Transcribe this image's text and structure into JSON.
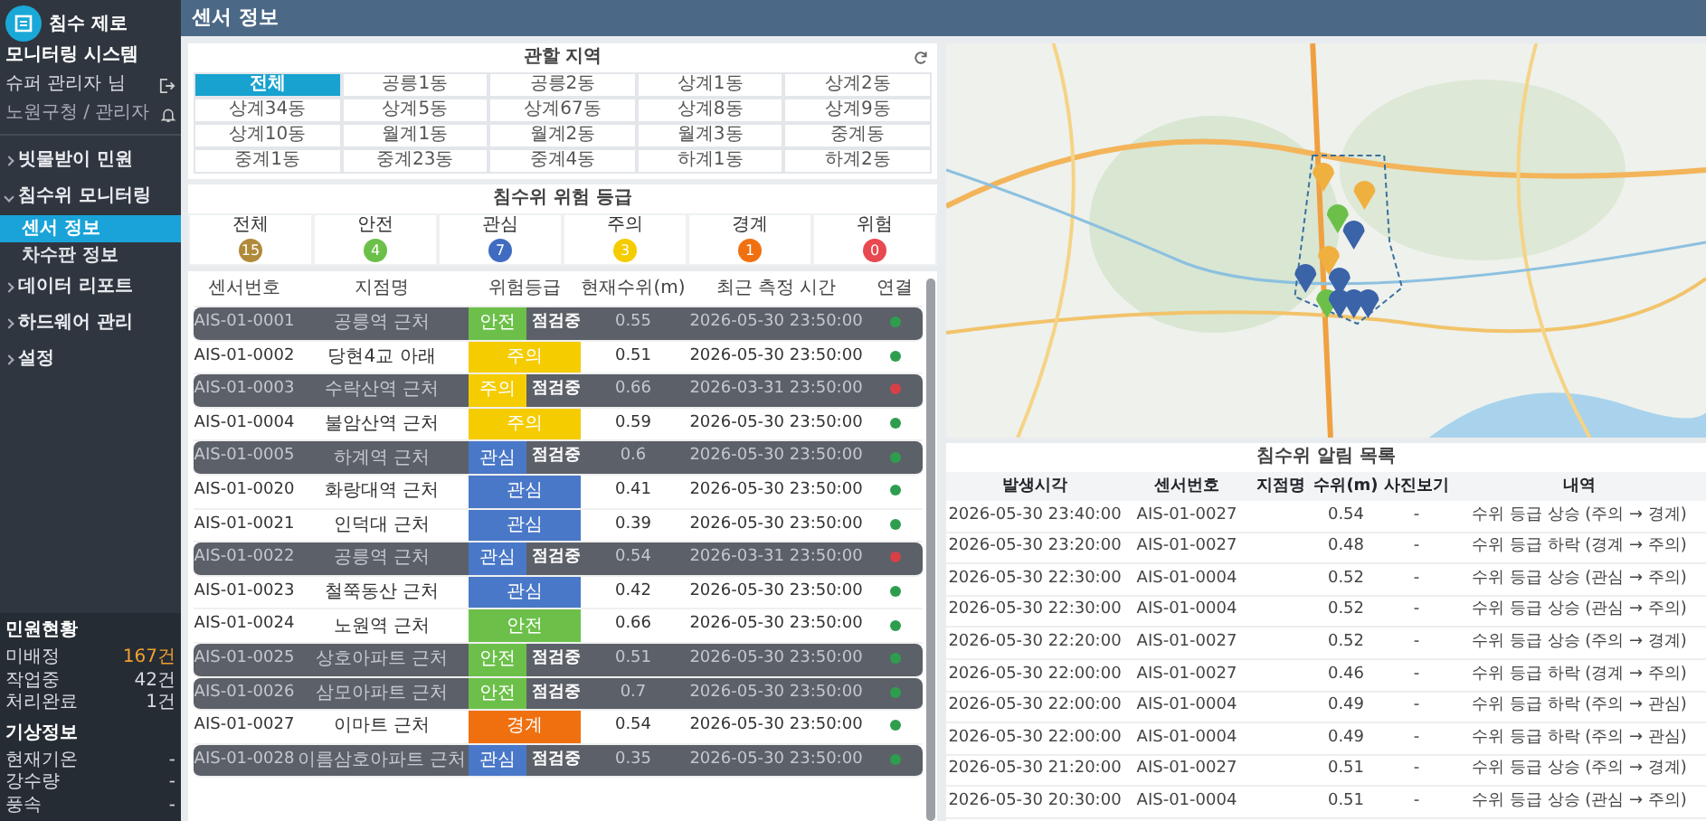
{
  "brand": {
    "title": "침수 제로",
    "subtitle": "모니터링 시스템"
  },
  "user": {
    "name": "슈퍼 관리자 님",
    "role": "노원구청 / 관리자"
  },
  "menu": [
    {
      "label": "빗물받이 민원",
      "expanded": false,
      "selected": false
    },
    {
      "label": "침수위 모니터링",
      "expanded": true,
      "selected": false,
      "children": [
        {
          "label": "센서 정보",
          "selected": true
        },
        {
          "label": "차수판 정보",
          "selected": false
        }
      ]
    },
    {
      "label": "데이터 리포트",
      "expanded": false,
      "selected": false
    },
    {
      "label": "하드웨어 관리",
      "expanded": false,
      "selected": false
    },
    {
      "label": "설정",
      "expanded": false,
      "selected": false
    }
  ],
  "complaints": {
    "title": "민원현황",
    "rows": [
      {
        "label": "미배정",
        "value": "167건",
        "highlight": true
      },
      {
        "label": "작업중",
        "value": "42건",
        "highlight": false
      },
      {
        "label": "처리완료",
        "value": "1건",
        "highlight": false
      }
    ]
  },
  "weather": {
    "title": "기상정보",
    "rows": [
      {
        "label": "현재기온",
        "value": "-"
      },
      {
        "label": "강수량",
        "value": "-"
      },
      {
        "label": "풍속",
        "value": "-"
      }
    ]
  },
  "page_title": "센서 정보",
  "regions": {
    "title": "관할 지역",
    "items": [
      {
        "label": "전체",
        "selected": true
      },
      {
        "label": "공릉1동",
        "selected": false
      },
      {
        "label": "공릉2동",
        "selected": false
      },
      {
        "label": "상계1동",
        "selected": false
      },
      {
        "label": "상계2동",
        "selected": false
      },
      {
        "label": "상계34동",
        "selected": false
      },
      {
        "label": "상계5동",
        "selected": false
      },
      {
        "label": "상계67동",
        "selected": false
      },
      {
        "label": "상계8동",
        "selected": false
      },
      {
        "label": "상계9동",
        "selected": false
      },
      {
        "label": "상계10동",
        "selected": false
      },
      {
        "label": "월계1동",
        "selected": false
      },
      {
        "label": "월계2동",
        "selected": false
      },
      {
        "label": "월계3동",
        "selected": false
      },
      {
        "label": "중계동",
        "selected": false
      },
      {
        "label": "중계1동",
        "selected": false
      },
      {
        "label": "중계23동",
        "selected": false
      },
      {
        "label": "중계4동",
        "selected": false
      },
      {
        "label": "하계1동",
        "selected": false
      },
      {
        "label": "하계2동",
        "selected": false
      }
    ]
  },
  "risk_levels": {
    "title": "침수위 위험 등급",
    "items": [
      {
        "label": "전체",
        "count": "15",
        "color": "#b08a3a"
      },
      {
        "label": "안전",
        "count": "4",
        "color": "#6cc04a"
      },
      {
        "label": "관심",
        "count": "7",
        "color": "#3f6cc0"
      },
      {
        "label": "주의",
        "count": "3",
        "color": "#f5cc00"
      },
      {
        "label": "경계",
        "count": "1",
        "color": "#f07010"
      },
      {
        "label": "위험",
        "count": "0",
        "color": "#e84850"
      }
    ]
  },
  "sensors": {
    "columns": [
      "센서번호",
      "지점명",
      "위험등급",
      "현재수위(m)",
      "최근 측정 시간",
      "연결"
    ],
    "rows": [
      {
        "id": "AIS-01-0001",
        "location": "공릉역 근처",
        "grade": "안전",
        "color": "#6cc04a",
        "level": "0.55",
        "time": "2026-05-30 23:50:00",
        "connected": true,
        "inspecting": true,
        "overlay_label": "점검중"
      },
      {
        "id": "AIS-01-0002",
        "location": "당현4교 아래",
        "grade": "주의",
        "color": "#f5cc00",
        "level": "0.51",
        "time": "2026-05-30 23:50:00",
        "connected": true,
        "inspecting": false
      },
      {
        "id": "AIS-01-0003",
        "location": "수락산역 근처",
        "grade": "주의",
        "color": "#f5cc00",
        "level": "0.66",
        "time": "2026-03-31 23:50:00",
        "connected": false,
        "inspecting": true,
        "overlay_label": "점검중"
      },
      {
        "id": "AIS-01-0004",
        "location": "불암산역 근처",
        "grade": "주의",
        "color": "#f5cc00",
        "level": "0.59",
        "time": "2026-05-30 23:50:00",
        "connected": true,
        "inspecting": false
      },
      {
        "id": "AIS-01-0005",
        "location": "하계역 근처",
        "grade": "관심",
        "color": "#4a78c8",
        "level": "0.6",
        "time": "2026-05-30 23:50:00",
        "connected": true,
        "inspecting": true,
        "overlay_label": "점검중"
      },
      {
        "id": "AIS-01-0020",
        "location": "화랑대역 근처",
        "grade": "관심",
        "color": "#4a78c8",
        "level": "0.41",
        "time": "2026-05-30 23:50:00",
        "connected": true,
        "inspecting": false
      },
      {
        "id": "AIS-01-0021",
        "location": "인덕대 근처",
        "grade": "관심",
        "color": "#4a78c8",
        "level": "0.39",
        "time": "2026-05-30 23:50:00",
        "connected": true,
        "inspecting": false
      },
      {
        "id": "AIS-01-0022",
        "location": "공릉역 근처",
        "grade": "관심",
        "color": "#4a78c8",
        "level": "0.54",
        "time": "2026-03-31 23:50:00",
        "connected": false,
        "inspecting": true,
        "overlay_label": "점검중"
      },
      {
        "id": "AIS-01-0023",
        "location": "철쭉동산 근처",
        "grade": "관심",
        "color": "#4a78c8",
        "level": "0.42",
        "time": "2026-05-30 23:50:00",
        "connected": true,
        "inspecting": false
      },
      {
        "id": "AIS-01-0024",
        "location": "노원역 근처",
        "grade": "안전",
        "color": "#6cc04a",
        "level": "0.66",
        "time": "2026-05-30 23:50:00",
        "connected": true,
        "inspecting": false
      },
      {
        "id": "AIS-01-0025",
        "location": "상호아파트 근처",
        "grade": "안전",
        "color": "#6cc04a",
        "level": "0.51",
        "time": "2026-05-30 23:50:00",
        "connected": true,
        "inspecting": true,
        "overlay_label": "점검중"
      },
      {
        "id": "AIS-01-0026",
        "location": "삼모아파트 근처",
        "grade": "안전",
        "color": "#6cc04a",
        "level": "0.7",
        "time": "2026-05-30 23:50:00",
        "connected": true,
        "inspecting": true,
        "overlay_label": "점검중"
      },
      {
        "id": "AIS-01-0027",
        "location": "이마트 근처",
        "grade": "경계",
        "color": "#f07010",
        "level": "0.54",
        "time": "2026-05-30 23:50:00",
        "connected": true,
        "inspecting": false
      },
      {
        "id": "AIS-01-0028",
        "location": "이름삼호아파트 근처",
        "grade": "관심",
        "color": "#4a78c8",
        "level": "0.35",
        "time": "2026-05-30 23:50:00",
        "connected": true,
        "inspecting": true,
        "overlay_label": "점검중"
      }
    ]
  },
  "alerts": {
    "title": "침수위 알림 목록",
    "columns": [
      "발생시각",
      "센서번호",
      "지점명",
      "수위(m)",
      "사진보기",
      "내역"
    ],
    "rows": [
      {
        "time": "2026-05-30 23:40:00",
        "sensor": "AIS-01-0027",
        "level": "0.54",
        "photo": "-",
        "detail": "수위 등급 상승 (주의 → 경계)"
      },
      {
        "time": "2026-05-30 23:20:00",
        "sensor": "AIS-01-0027",
        "level": "0.48",
        "photo": "-",
        "detail": "수위 등급 하락 (경계 → 주의)"
      },
      {
        "time": "2026-05-30 22:30:00",
        "sensor": "AIS-01-0004",
        "level": "0.52",
        "photo": "-",
        "detail": "수위 등급 상승 (관심 → 주의)"
      },
      {
        "time": "2026-05-30 22:30:00",
        "sensor": "AIS-01-0004",
        "level": "0.52",
        "photo": "-",
        "detail": "수위 등급 상승 (관심 → 주의)"
      },
      {
        "time": "2026-05-30 22:20:00",
        "sensor": "AIS-01-0027",
        "level": "0.52",
        "photo": "-",
        "detail": "수위 등급 상승 (주의 → 경계)"
      },
      {
        "time": "2026-05-30 22:00:00",
        "sensor": "AIS-01-0027",
        "level": "0.46",
        "photo": "-",
        "detail": "수위 등급 하락 (경계 → 주의)"
      },
      {
        "time": "2026-05-30 22:00:00",
        "sensor": "AIS-01-0004",
        "level": "0.49",
        "photo": "-",
        "detail": "수위 등급 하락 (주의 → 관심)"
      },
      {
        "time": "2026-05-30 22:00:00",
        "sensor": "AIS-01-0004",
        "level": "0.49",
        "photo": "-",
        "detail": "수위 등급 하락 (주의 → 관심)"
      },
      {
        "time": "2026-05-30 21:20:00",
        "sensor": "AIS-01-0027",
        "level": "0.51",
        "photo": "-",
        "detail": "수위 등급 상승 (주의 → 경계)"
      },
      {
        "time": "2026-05-30 20:30:00",
        "sensor": "AIS-01-0004",
        "level": "0.51",
        "photo": "-",
        "detail": "수위 등급 상승 (관심 → 주의)"
      }
    ]
  }
}
